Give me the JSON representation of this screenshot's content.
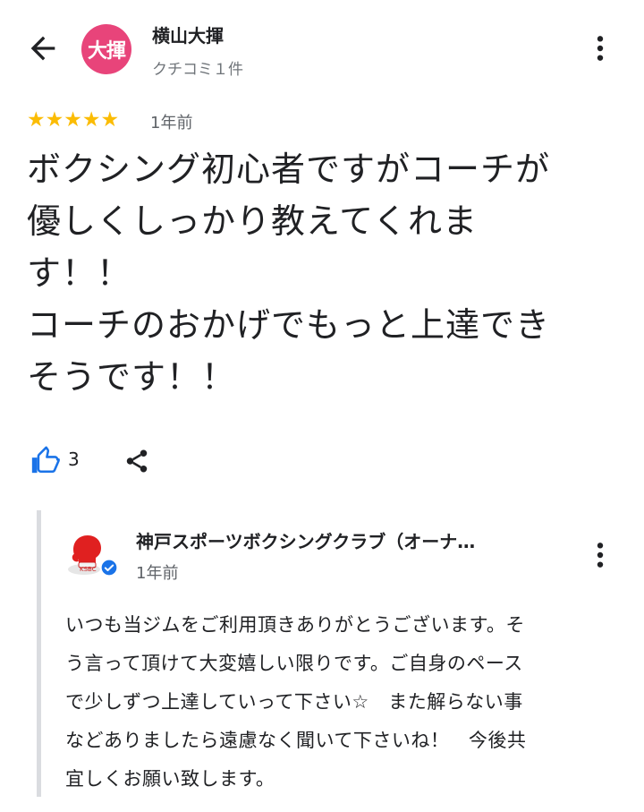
{
  "header": {
    "avatar_text": "大揮",
    "user_name": "横山大揮",
    "review_count": "クチコミ１件"
  },
  "review": {
    "rating": 5,
    "stars": "★★★★★",
    "age": "1年前",
    "text": "ボクシング初心者ですがコーチが\n優しくしっかり教えてくれま\nす！！\nコーチのおかげでもっと上達でき\nそうです！！",
    "like_count": "3"
  },
  "owner_reply": {
    "name": "神戸スポーツボクシングクラブ（オーナ…",
    "age": "1年前",
    "text": "いつも当ジムをご利用頂きありがとうございます。そ\nう言って頂けて大変嬉しい限りです。ご自身のペース\nで少しずつ上達していって下さい☆　また解らない事\nなどありましたら遠慮なく聞いて下さいね！　今後共\n宜しくお願い致します。"
  },
  "colors": {
    "avatar_bg": "#e8447a",
    "star": "#fbbc04",
    "like_blue": "#1a73e8",
    "verified_blue": "#1a73e8",
    "reply_bar": "#dadce0"
  },
  "icons": [
    "arrow-back-icon",
    "more-vert-icon",
    "thumb-up-icon",
    "share-icon",
    "verified-badge-icon"
  ]
}
